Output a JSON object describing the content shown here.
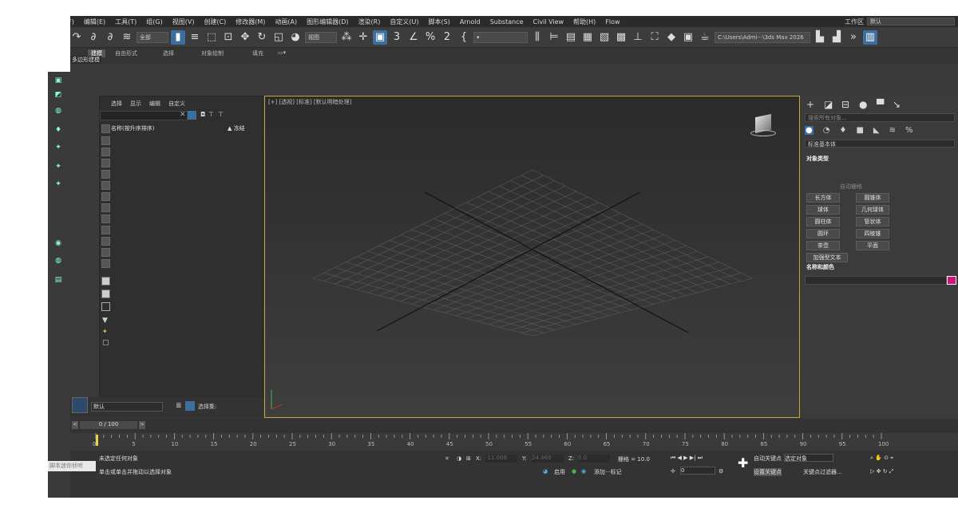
{
  "menu": [
    "文件(F)",
    "编辑(E)",
    "工具(T)",
    "组(G)",
    "视图(V)",
    "创建(C)",
    "修改器(M)",
    "动画(A)",
    "图形编辑器(D)",
    "渲染(R)",
    "自定义(U)",
    "脚本(S)",
    "Arnold",
    "Substance",
    "Civil View",
    "帮助(H)",
    "Flow"
  ],
  "workspace": {
    "label": "工作区",
    "value": "默认"
  },
  "toolbar": {
    "selection_filter": "全部",
    "ref_coord": "视图",
    "path": "C:\\Users\\Admi···\\3ds Max 2026",
    "percent_label": "3",
    "snap_value": "2"
  },
  "ribbon": {
    "tabs": [
      "建模",
      "自由形式",
      "选择",
      "对象绘制",
      "填充"
    ],
    "sub": "多边形建模"
  },
  "explorer": {
    "menus": [
      "选择",
      "显示",
      "编辑",
      "自定义"
    ],
    "col_name": "名称(按升序排序)",
    "col_freeze": "▲ 冻结",
    "layer": "默认",
    "selset": "选择集:"
  },
  "viewport": {
    "label": "[+] [透视] [标准] [默认明暗处理] "
  },
  "cmdpanel": {
    "search": "搜索所有对象...",
    "category": "标准基本体",
    "section_objtype": "对象类型",
    "autogrid": "自动栅格",
    "buttons": [
      "长方体",
      "圆锥体",
      "球体",
      "几何球体",
      "圆柱体",
      "管状体",
      "圆环",
      "四棱锥",
      "茶壶",
      "平面",
      "加强型文本"
    ],
    "section_namecolor": "名称和颜色",
    "swatch_color": "#d4147a"
  },
  "timeslider": {
    "frame": "0 / 100"
  },
  "timeline": {
    "ticks": [
      "0",
      "5",
      "10",
      "15",
      "20",
      "25",
      "30",
      "35",
      "40",
      "45",
      "50",
      "55",
      "60",
      "65",
      "70",
      "75",
      "80",
      "85",
      "90",
      "95",
      "100"
    ]
  },
  "status": {
    "line1": "未选定任何对象",
    "line2": "单击或单击并拖动以选择对象",
    "maxscript": "脚本迷你侦听",
    "x_label": "X:",
    "x_val": "-11.008",
    "y_label": "Y:",
    "y_val": "24.469",
    "z_label": "Z:",
    "z_val": "0.0",
    "grid": "栅格 = 10.0",
    "enabled": "启用",
    "add_tag": "添加···标记",
    "autokey": "自动关键点",
    "selected": "选定对象",
    "setkey": "设置关键点",
    "keyfilter": "关键点过滤器...",
    "frame_field": "0"
  }
}
